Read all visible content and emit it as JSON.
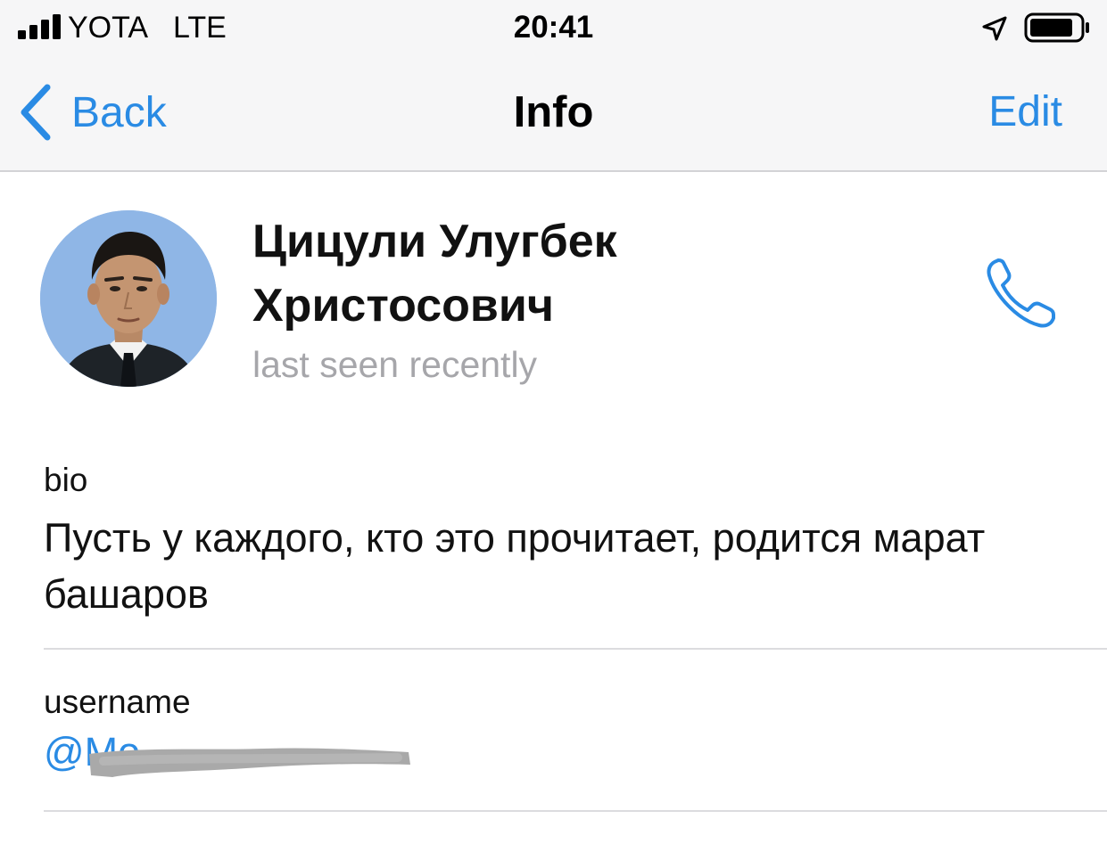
{
  "status_bar": {
    "carrier": "YOTA",
    "network": "LTE",
    "time": "20:41",
    "icons": [
      "signal-icon",
      "location-arrow-icon",
      "battery-icon"
    ]
  },
  "nav": {
    "back_label": "Back",
    "title": "Info",
    "edit_label": "Edit"
  },
  "profile": {
    "name": "Цицули Улугбек Христосович",
    "status": "last seen recently"
  },
  "bio": {
    "label": "bio",
    "text": "Пусть у каждого, кто это прочитает, родится марат башаров"
  },
  "username": {
    "label": "username",
    "value": "@Mo"
  },
  "colors": {
    "accent": "#2a8be4",
    "secondary_text": "#a6a6aa",
    "nav_background": "#f6f6f7",
    "avatar_background": "#8fb6e6"
  }
}
